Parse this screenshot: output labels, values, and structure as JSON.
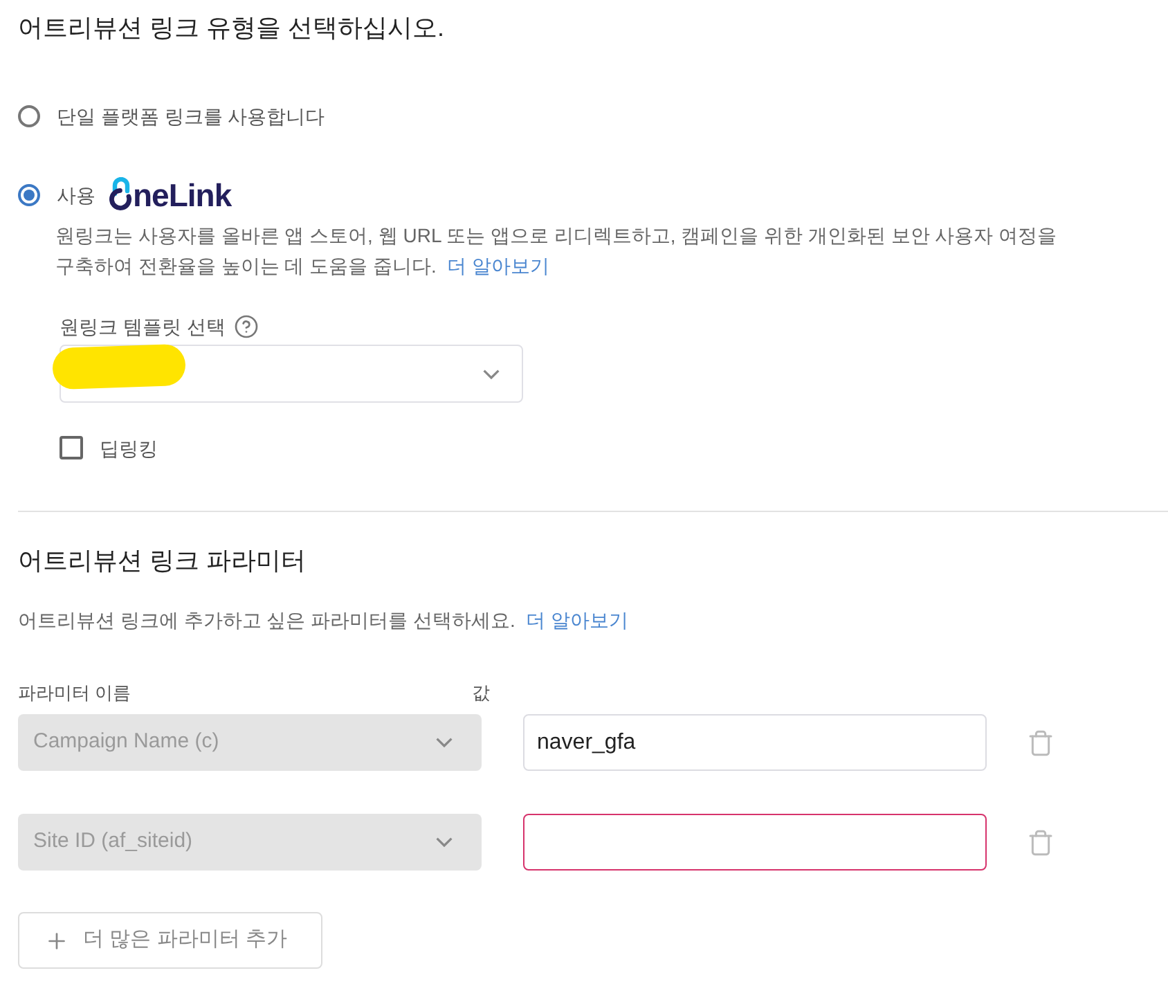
{
  "heading": "어트리뷰션 링크 유형을 선택하십시오.",
  "link_types": [
    {
      "kind": "plain",
      "label": "단일 플랫폼 링크를 사용합니다",
      "selected": false
    },
    {
      "kind": "onelink",
      "label": "사용",
      "logo_text": "neLink",
      "selected": true,
      "description": "원링크는 사용자를 올바른 앱 스토어, 웹 URL 또는 앱으로 리디렉트하고, 캠페인을 위한 개인화된 보안 사용자 여정을 구축하여 전환율을 높이는 데 도움을 줍니다.",
      "learn_more": "더 알아보기",
      "template": {
        "label": "원링크 템플릿 선택",
        "redacted": true
      },
      "deep_linking": {
        "label": "딥링킹",
        "checked": false
      }
    }
  ],
  "parameters": {
    "title": "어트리뷰션 링크 파라미터",
    "description": "어트리뷰션 링크에 추가하고 싶은 파라미터를 선택하세요.",
    "learn_more": "더 알아보기",
    "columns": [
      "파라미터 이름",
      "값"
    ],
    "rows": [
      {
        "name": "Campaign Name (c)",
        "disabled": true,
        "value": "naver_gfa",
        "invalid": false
      },
      {
        "name": "Site ID (af_siteid)",
        "disabled": true,
        "invalid": true
      }
    ],
    "add_button": "더 많은 파라미터 추가"
  }
}
